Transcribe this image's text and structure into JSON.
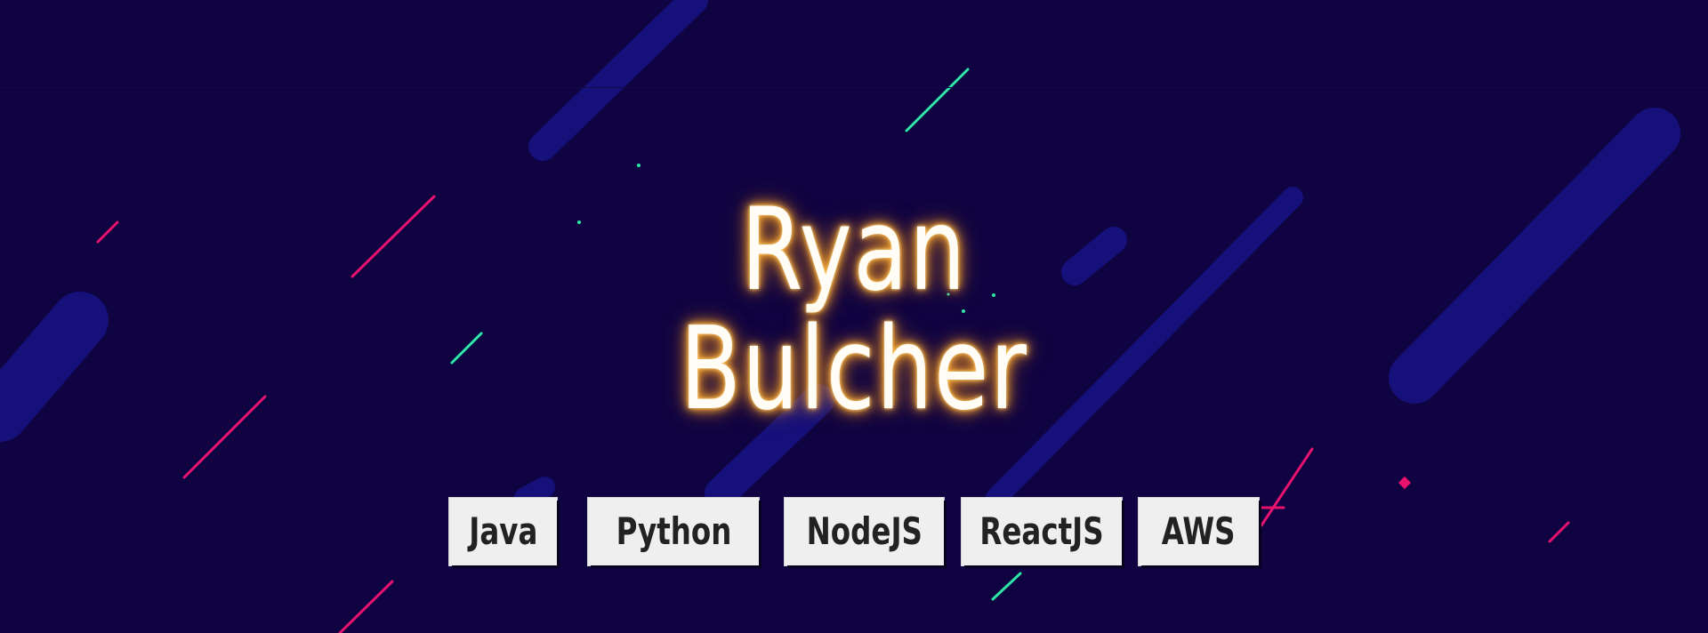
{
  "hero": {
    "first_name": "Ryan",
    "last_name": "Bulcher"
  },
  "skills": [
    "Java",
    "Python",
    "NodeJS",
    "ReactJS",
    "AWS"
  ],
  "colors": {
    "background": "#0f0341",
    "stripe": "#15107a",
    "accent_pink": "#e8126f",
    "accent_green": "#2ee6a6",
    "glow": "#ffb43c"
  }
}
